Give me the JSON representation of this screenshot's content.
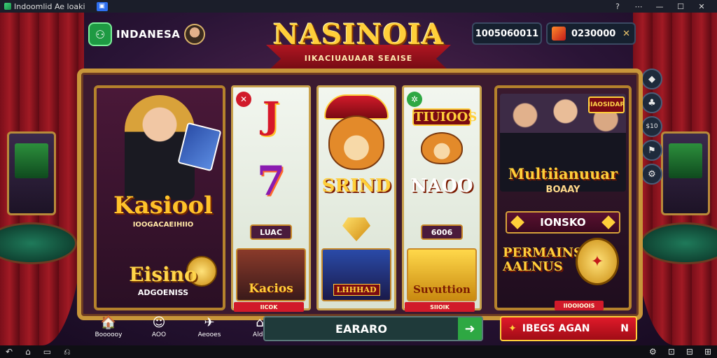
{
  "window": {
    "title": "Indoomlid Ae loaki",
    "tab_icon": "tv-icon",
    "controls": [
      "?",
      "⋯",
      "—",
      "☐",
      "✕"
    ]
  },
  "header": {
    "game_icon": "⚇",
    "player_name": "INDANESA",
    "logo_title": "NASINOIA",
    "logo_sub": "IIKACIUAUAAR SEAISE",
    "balance": "1005060011",
    "gems": "0230000",
    "gems_close": "✕"
  },
  "side_buttons": [
    "◆",
    "♣",
    "$10",
    "⚑",
    "⚙"
  ],
  "kasino_card": {
    "title": "Kasiool",
    "subtitle": "IOOGACAEIHIIO",
    "logo2_title": "Eisino",
    "logo2_sub": "ADGOENISS"
  },
  "reels": [
    {
      "badge": "✕",
      "badge_color": "#d11a2a",
      "top_symbol": "J",
      "mid_symbol": "7",
      "pill": "LUAC",
      "thumb_label": "Kacios",
      "under_tag": "IICOK"
    },
    {
      "top_word": "",
      "mid_word": "SRIND",
      "thumb_label": "LHHHAD"
    },
    {
      "badge": "✲",
      "badge_color": "#2ea843",
      "top_word": "TIUIOOS",
      "mid_word": "NAOO",
      "pill": "6006",
      "thumb_label": "Suvuttion",
      "under_tag": "SIIOIK"
    }
  ],
  "feature_card": {
    "tag": "IIAOSIDAR",
    "title": "Multiianuuar",
    "subtitle": "BOAAY",
    "button": "IONSKO",
    "promo_text": "PERMAINS AALNUS",
    "under_tag": "IIOOIOOIS"
  },
  "bottom_nav": [
    {
      "icon": "🏠",
      "label": "Boooooy"
    },
    {
      "icon": "☺",
      "label": "AOO"
    },
    {
      "icon": "✈",
      "label": "Aeooes"
    },
    {
      "icon": "⌂",
      "label": "Aldo"
    }
  ],
  "search": {
    "value": "EARARO",
    "go": "➜"
  },
  "cta": {
    "icon": "✦",
    "label": "IBEGS AGAN",
    "close": "N"
  },
  "android_bar": {
    "left": [
      "↶",
      "⌂",
      "▭",
      "⎌"
    ],
    "right": [
      "⚙",
      "⊡",
      "⊟",
      "⊞"
    ]
  }
}
